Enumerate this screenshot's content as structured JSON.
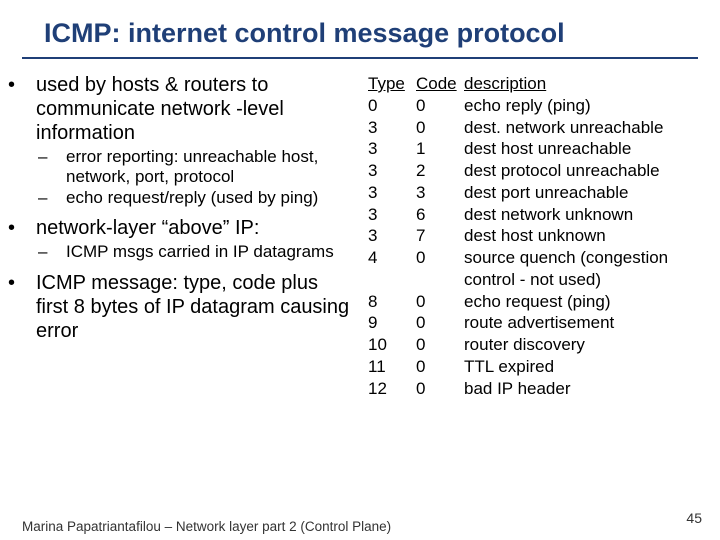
{
  "title": "ICMP: internet control message protocol",
  "left": {
    "b1_1": "used by hosts & routers to communicate network -level information",
    "b2_1": "error reporting: unreachable host, network, port, protocol",
    "b2_2": "echo request/reply (used by ping)",
    "b1_2": "network-layer “above” IP:",
    "b2_3": "ICMP msgs carried in IP datagrams",
    "b1_3": "ICMP message: type, code plus first 8 bytes of IP datagram causing error"
  },
  "table": {
    "h1": "Type",
    "h2": "Code",
    "h3": "description",
    "rows": [
      {
        "t": "0",
        "c": "0",
        "d": "echo reply (ping)"
      },
      {
        "t": "3",
        "c": "0",
        "d": "dest. network unreachable"
      },
      {
        "t": "3",
        "c": "1",
        "d": "dest host unreachable"
      },
      {
        "t": "3",
        "c": "2",
        "d": "dest protocol unreachable"
      },
      {
        "t": "3",
        "c": "3",
        "d": "dest port unreachable"
      },
      {
        "t": "3",
        "c": "6",
        "d": "dest network unknown"
      },
      {
        "t": "3",
        "c": "7",
        "d": "dest host unknown"
      },
      {
        "t": "4",
        "c": "0",
        "d": "source quench (congestion control - not used)"
      },
      {
        "t": "8",
        "c": "0",
        "d": "echo request (ping)"
      },
      {
        "t": "9",
        "c": "0",
        "d": "route advertisement"
      },
      {
        "t": "10",
        "c": "0",
        "d": "router discovery"
      },
      {
        "t": "11",
        "c": "0",
        "d": "TTL expired"
      },
      {
        "t": "12",
        "c": "0",
        "d": "bad IP header"
      }
    ]
  },
  "footer": "Marina Papatriantafilou – Network layer part 2 (Control Plane)",
  "pagenum": "45"
}
